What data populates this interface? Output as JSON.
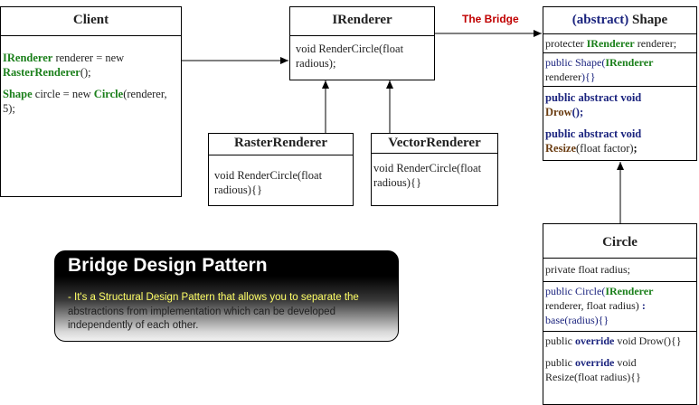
{
  "client": {
    "title": "Client",
    "line1_type": "IRenderer",
    "line1_rest": " renderer = new ",
    "line1_ctor": "RasterRenderer",
    "line1_end": "();",
    "line2_type": "Shape",
    "line2_rest": " circle = new ",
    "line2_ctor": "Circle",
    "line2_end": "(renderer,",
    "line2_end2": "5);"
  },
  "irenderer": {
    "title": "IRenderer",
    "method": "void RenderCircle(float radious);"
  },
  "bridge_label": "The Bridge",
  "shape": {
    "title_abstract": "(abstract)",
    "title_name": " Shape",
    "field_pre": "protecter ",
    "field_type": "IRenderer",
    "field_post": " renderer;",
    "ctor_pre": "public ",
    "ctor_name": "Shape(",
    "ctor_type": "IRenderer",
    "ctor_post": " renderer",
    "ctor_end": "){}",
    "m1_mod": "public abstract void",
    "m1_name": "Drow",
    "m1_end": "();",
    "m2_mod": "public abstract void",
    "m2_name": "Resize",
    "m2_args": "(float factor)",
    "m2_end": ";"
  },
  "raster": {
    "title": "RasterRenderer",
    "method": "void RenderCircle(float radious){}"
  },
  "vector": {
    "title": "VectorRenderer",
    "method": "void RenderCircle(float radious){}"
  },
  "circle": {
    "title": "Circle",
    "field": "private float radius;",
    "ctor_pre": "public Circle(",
    "ctor_type": "IRenderer",
    "ctor_mid": "renderer, float radius)",
    "ctor_colon": " :",
    "ctor_base": "base",
    "ctor_end": "(radius){}",
    "m1_pre": "public ",
    "m1_kw": "override",
    "m1_post": " void Drow(){}",
    "m2_pre": "public ",
    "m2_kw": "override",
    "m2_post": " void",
    "m2_line2": "Resize(float radius){}"
  },
  "card": {
    "title": "Bridge Design Pattern",
    "line1": "- It's a Structural Design Pattern that allows you to separate the",
    "line2": "abstractions from implementation which can be developed independently of each other."
  },
  "colors": {
    "type_green": "#1a7f1a",
    "keyword_blue": "#1a237e",
    "method_brown": "#6b3d12",
    "bridge_red": "#c00000",
    "card_highlight": "#ffff66"
  }
}
